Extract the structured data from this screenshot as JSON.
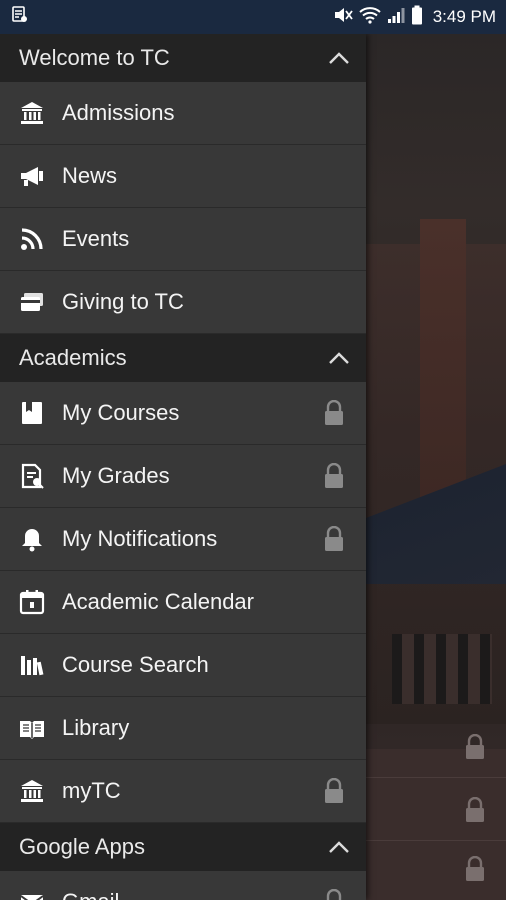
{
  "status_bar": {
    "time": "3:49 PM",
    "icons": [
      "notification-app-icon",
      "mute-icon",
      "wifi-icon",
      "signal-icon",
      "battery-icon"
    ]
  },
  "drawer": {
    "sections": [
      {
        "title": "Welcome to TC",
        "expanded": true,
        "items": [
          {
            "label": "Admissions",
            "icon": "institution-icon",
            "locked": false
          },
          {
            "label": "News",
            "icon": "megaphone-icon",
            "locked": false
          },
          {
            "label": "Events",
            "icon": "rss-icon",
            "locked": false
          },
          {
            "label": "Giving to TC",
            "icon": "credit-card-icon",
            "locked": false
          }
        ]
      },
      {
        "title": "Academics",
        "expanded": true,
        "items": [
          {
            "label": "My Courses",
            "icon": "book-icon",
            "locked": true
          },
          {
            "label": "My Grades",
            "icon": "grade-document-icon",
            "locked": true
          },
          {
            "label": "My Notifications",
            "icon": "bell-icon",
            "locked": true
          },
          {
            "label": "Academic Calendar",
            "icon": "calendar-icon",
            "locked": false
          },
          {
            "label": "Course Search",
            "icon": "bookshelf-icon",
            "locked": false
          },
          {
            "label": "Library",
            "icon": "open-book-icon",
            "locked": false
          },
          {
            "label": "myTC",
            "icon": "institution-icon",
            "locked": true
          }
        ]
      },
      {
        "title": "Google Apps",
        "expanded": true,
        "items": [
          {
            "label": "Gmail",
            "icon": "mail-icon",
            "locked": true
          }
        ]
      }
    ]
  },
  "colors": {
    "status_bar_bg": "#1a2940",
    "drawer_bg": "#383838",
    "section_header_bg": "#232323",
    "text": "#f4f4f4",
    "lock": "#8a8a8a"
  }
}
